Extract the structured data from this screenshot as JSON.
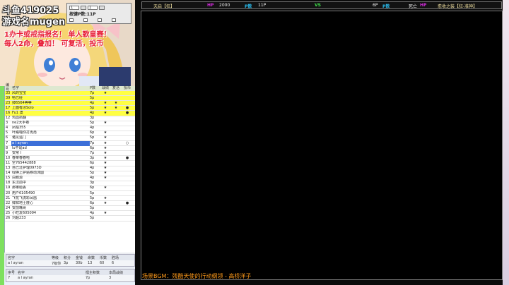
{
  "overlay": {
    "room_id": "斗鱼419025",
    "game_name": "游戏名mugen",
    "promo_line1": "1办卡或戒指报名！ 单人歌皇赛！",
    "promo_line2": "每人2命，叠加！ 可复活，投币"
  },
  "widget": {
    "field1": "1",
    "field2": "1",
    "line2": "按键P数:11P"
  },
  "roster": {
    "columns": [
      "编号",
      "名字",
      "P数",
      "战绩",
      "复活",
      "投币"
    ],
    "rows": [
      {
        "no": "33",
        "name": "风的宝宝",
        "p": "7p",
        "b": "★",
        "c": "",
        "d": "",
        "yellow": true
      },
      {
        "no": "39",
        "name": "哈已经",
        "p": "5p",
        "b": "",
        "c": "",
        "d": "",
        "yellow": true
      },
      {
        "no": "23",
        "name": "掉6564等等",
        "p": "4p",
        "b": "★",
        "c": "★",
        "d": "",
        "yellow": true
      },
      {
        "no": "17",
        "name": "上面有冰Solo",
        "p": "5p",
        "b": "★",
        "c": "★",
        "d": "●",
        "yellow": true
      },
      {
        "no": "16",
        "name": "Fu1 澳",
        "p": "4p",
        "b": "★",
        "c": "",
        "d": "●",
        "yellow": true
      },
      {
        "no": "12",
        "name": "鸡血抓翻",
        "p": "3p",
        "b": "",
        "c": "",
        "d": "",
        "yellow": false
      },
      {
        "no": "3",
        "name": "ne2大手卷",
        "p": "5p",
        "b": "★",
        "c": "",
        "d": "",
        "yellow": false
      },
      {
        "no": "4",
        "name": "凤柏355",
        "p": "4p",
        "b": "",
        "c": "",
        "d": "",
        "yellow": false
      },
      {
        "no": "5",
        "name": "叶路喵你打再再",
        "p": "6p",
        "b": "★",
        "c": "",
        "d": "",
        "yellow": false
      },
      {
        "no": "6",
        "name": "诸见遥门",
        "p": "5p",
        "b": "★",
        "c": "",
        "d": "",
        "yellow": false
      },
      {
        "no": "7",
        "name": "a l ayran",
        "p": "7p",
        "b": "★",
        "c": "",
        "d": "○",
        "yellow": false,
        "selected": true
      },
      {
        "no": "8",
        "name": "lu不是ad",
        "p": "6p",
        "b": "★",
        "c": "",
        "d": "",
        "yellow": false
      },
      {
        "no": "9",
        "name": "安常 l",
        "p": "7p",
        "b": "★",
        "c": "",
        "d": "",
        "yellow": false
      },
      {
        "no": "10",
        "name": "春菜春春啦",
        "p": "3p",
        "b": "★",
        "c": "",
        "d": "●",
        "yellow": false
      },
      {
        "no": "11",
        "name": "空765442888",
        "p": "6p",
        "b": "★",
        "c": "",
        "d": "",
        "yellow": false
      },
      {
        "no": "13",
        "name": "自己过护理0973D",
        "p": "4p",
        "b": "★",
        "c": "",
        "d": "",
        "yellow": false
      },
      {
        "no": "14",
        "name": "绿换上护贴移动沫圆",
        "p": "5p",
        "b": "★",
        "c": "",
        "d": "",
        "yellow": false
      },
      {
        "no": "15",
        "name": "白鹅源",
        "p": "4p",
        "b": "★",
        "c": "",
        "d": "",
        "yellow": false
      },
      {
        "no": "18",
        "name": "东汉前中",
        "p": "3p",
        "b": "",
        "c": "",
        "d": "",
        "yellow": false
      },
      {
        "no": "19",
        "name": "那哪给丢",
        "p": "6p",
        "b": "★",
        "c": "",
        "d": "",
        "yellow": false
      },
      {
        "no": "20",
        "name": "用户6105490",
        "p": "5p",
        "b": "",
        "c": "",
        "d": "",
        "yellow": false
      },
      {
        "no": "21",
        "name": "飞花飞流彩凤凰",
        "p": "5p",
        "b": "★",
        "c": "",
        "d": "",
        "yellow": false
      },
      {
        "no": "22",
        "name": "鲜鲜地士度心",
        "p": "6p",
        "b": "★",
        "c": "",
        "d": "●",
        "yellow": false
      },
      {
        "no": "24",
        "name": "安前嘴哥",
        "p": "5p",
        "b": "",
        "c": "",
        "d": "",
        "yellow": false
      },
      {
        "no": "25",
        "name": "小旺友605094",
        "p": "4p",
        "b": "★",
        "c": "",
        "d": "",
        "yellow": false
      },
      {
        "no": "26",
        "name": "刘超233",
        "p": "5p",
        "b": "",
        "c": "",
        "d": "",
        "yellow": false
      }
    ]
  },
  "stats_table": {
    "headers": [
      "名字",
      "等级",
      "积分",
      "金钱",
      "命数",
      "币数",
      "胜场"
    ],
    "row": [
      "a l ayran",
      "7级你",
      "3p",
      "30b",
      "13",
      "60",
      "6"
    ]
  },
  "current_table": {
    "headers": [
      "序号",
      "名字",
      "擂主积数",
      "本局战绩"
    ],
    "row": [
      "7",
      "a l ayran",
      "7p",
      "3"
    ]
  },
  "hud": {
    "left_name": "天启【狂】",
    "hp_label_left": "HP",
    "hp_left": "2000",
    "p_label_left": "P数",
    "p_left": "11P",
    "vs": "VS",
    "p_right": "6P",
    "p_label_right": "P数",
    "death_label": "死亡",
    "hp_label_right": "HP",
    "right_name": "愈收之装【狂-准神】"
  },
  "bgm": {
    "text": "场景BGM：残酷天使的行动纲领 - 高桥洋子"
  },
  "colors": {
    "highlight_yellow": "#ffff44",
    "selected_blue": "#3c6fd8",
    "bgm_orange": "#ff9a1a",
    "hp_magenta": "#d02ad8",
    "p_cyan": "#29b8e8",
    "vs_green": "#3fe04a"
  }
}
